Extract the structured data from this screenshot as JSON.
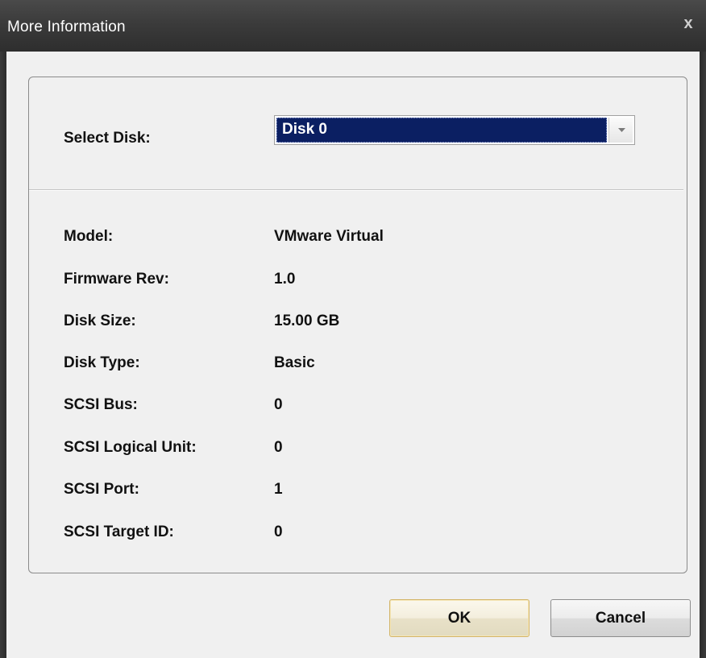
{
  "window": {
    "title": "More Information",
    "close_glyph": "x"
  },
  "select_disk": {
    "label": "Select Disk:",
    "value": "Disk 0"
  },
  "details": [
    {
      "label": "Model:",
      "value": "VMware  Virtual"
    },
    {
      "label": "Firmware Rev:",
      "value": "1.0"
    },
    {
      "label": "Disk Size:",
      "value": "15.00 GB"
    },
    {
      "label": "Disk Type:",
      "value": "Basic"
    },
    {
      "label": "SCSI Bus:",
      "value": "0"
    },
    {
      "label": "SCSI Logical Unit:",
      "value": "0"
    },
    {
      "label": "SCSI Port:",
      "value": "1"
    },
    {
      "label": "SCSI Target ID:",
      "value": "0"
    }
  ],
  "buttons": {
    "ok": "OK",
    "cancel": "Cancel"
  },
  "colors": {
    "title_bar": "#3b3b3b",
    "selection": "#0b1f62",
    "dialog_background": "#f0f0f0"
  }
}
